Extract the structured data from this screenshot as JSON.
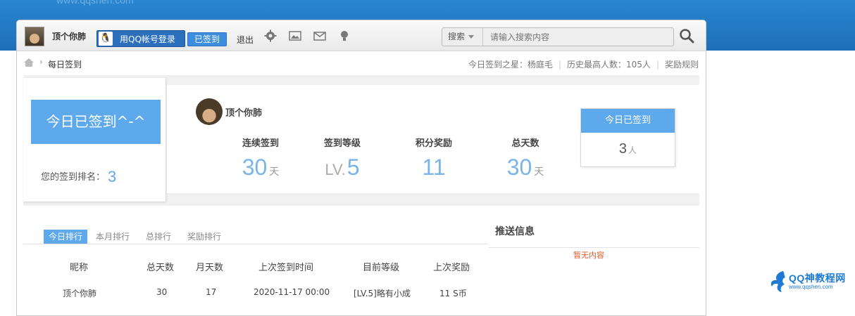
{
  "site_url": "www.qqshen.com",
  "toolbar": {
    "username": "顶个你肺",
    "qq_login_label": "用QQ帐号登录",
    "signed_label": "已签到",
    "logout_label": "退出",
    "icons": [
      "gear-icon",
      "image-icon",
      "mail-icon",
      "bulb-icon"
    ],
    "search_type": "搜索",
    "search_placeholder": "请输入搜索内容"
  },
  "breadcrumb": {
    "current": "每日签到",
    "star_of_day": "今日签到之星：杨庭毛",
    "highest_count": "历史最高人数：105人",
    "rules_link": "奖励规则"
  },
  "sign_panel": {
    "button_label": "今日已签到^-^",
    "rank_label": "您的签到排名：",
    "rank_value": "3"
  },
  "profile": {
    "username": "顶个你肺",
    "stats": [
      {
        "label": "连续签到",
        "value": "30",
        "unit": "天",
        "prefix": ""
      },
      {
        "label": "签到等级",
        "value": "5",
        "unit": "",
        "prefix": "LV."
      },
      {
        "label": "积分奖励",
        "value": "11",
        "unit": "",
        "prefix": ""
      },
      {
        "label": "总天数",
        "value": "30",
        "unit": "天",
        "prefix": ""
      }
    ]
  },
  "today_card": {
    "title": "今日已签到",
    "count": "3",
    "unit": "人"
  },
  "tabs": [
    "今日排行",
    "本月排行",
    "总排行",
    "奖励排行"
  ],
  "push": {
    "title": "推送信息",
    "empty": "暂无内容"
  },
  "table": {
    "headers": [
      "昵称",
      "总天数",
      "月天数",
      "上次签到时间",
      "目前等级",
      "上次奖励"
    ],
    "rows": [
      [
        "顶个你肺",
        "30",
        "17",
        "2020-11-17 00:00",
        "[LV.5]略有小成",
        "11 S币"
      ]
    ]
  },
  "watermark": {
    "title": "QQ神教程网",
    "url": "www.qqshen.com"
  },
  "colors": {
    "accent": "#5ea8ec",
    "header_bg": "#1e6fb8",
    "empty_text": "#e05a2a"
  }
}
